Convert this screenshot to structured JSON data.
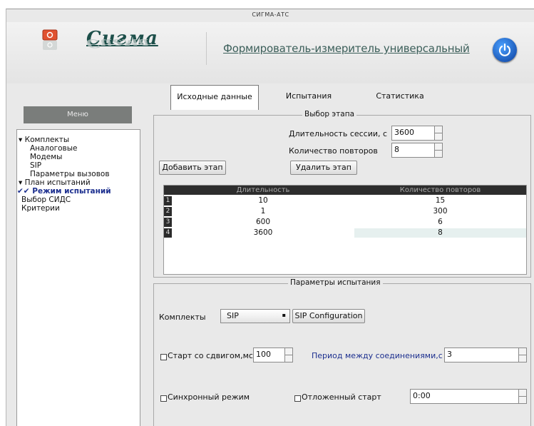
{
  "window": {
    "title": "СИГМА-АТС"
  },
  "header": {
    "logo_text": "Сигма",
    "app_title": "Формирователь-измеритель универсальный"
  },
  "menu": {
    "header": "Меню",
    "items": [
      {
        "label": "▾ Комплекты"
      },
      {
        "label": "Аналоговые"
      },
      {
        "label": "Модемы"
      },
      {
        "label": "SIP"
      },
      {
        "label": "Параметры вызовов"
      },
      {
        "label": "▾ План испытаний"
      },
      {
        "label": "✔✔ Режим испытаний"
      },
      {
        "label": "Выбор СИДС"
      },
      {
        "label": "Критерии"
      }
    ]
  },
  "tabs": [
    {
      "label": "Исходные данные"
    },
    {
      "label": "Испытания"
    },
    {
      "label": "Статистика"
    }
  ],
  "stage": {
    "group_title": "Выбор этапа",
    "session_label": "Длительность сессии, с",
    "session_value": "3600",
    "repeats_label": "Количество повторов",
    "repeats_value": "8",
    "add_button": "Добавить этап",
    "remove_button": "Удалить этап",
    "table": {
      "columns": [
        "Длительность",
        "Количество повторов"
      ],
      "rows": [
        {
          "n": "1",
          "duration": "10",
          "repeats": "15"
        },
        {
          "n": "2",
          "duration": "1",
          "repeats": "300"
        },
        {
          "n": "3",
          "duration": "600",
          "repeats": "6"
        },
        {
          "n": "4",
          "duration": "3600",
          "repeats": "8"
        }
      ]
    }
  },
  "params": {
    "group_title": "Параметры испытания",
    "kits_label": "Комплекты",
    "kits_value": "SIP",
    "sip_config_button": "SIP Configuration",
    "offset_label": "Старт со сдвигом,мс",
    "offset_value": "100",
    "period_label": "Период между соединениями,с",
    "period_value": "3",
    "sync_label": "Синхронный режим",
    "delayed_label": "Отложенный старт",
    "delayed_value": "0:00"
  },
  "colors": {
    "menu_header": "#7a7d7b",
    "table_header": "#2d2d2d",
    "power_button": "#1757c7",
    "logo": "#1d4f4a"
  }
}
